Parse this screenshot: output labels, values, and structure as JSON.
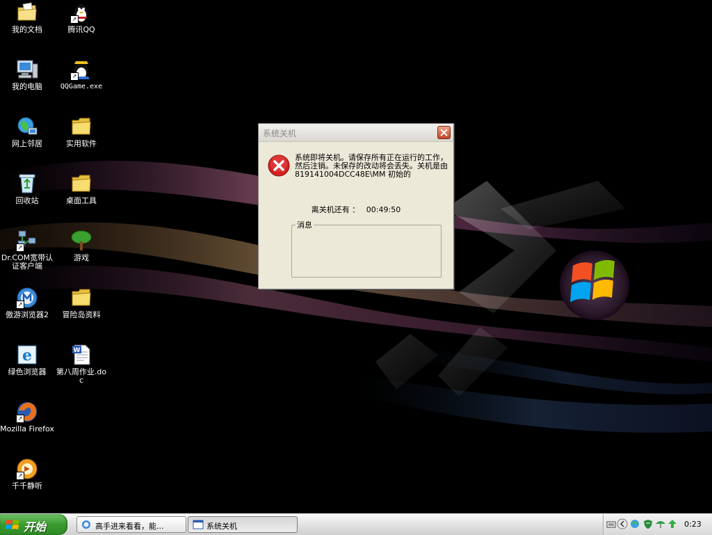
{
  "desktop": {
    "icons_col1": [
      {
        "label": "我的文档"
      },
      {
        "label": "我的电脑"
      },
      {
        "label": "网上邻居"
      },
      {
        "label": "回收站"
      },
      {
        "label": "Dr.COM宽带认证客户端"
      },
      {
        "label": "傲游浏览器2"
      },
      {
        "label": "绿色浏览器"
      },
      {
        "label": "Mozilla Firefox"
      },
      {
        "label": "千千静听"
      }
    ],
    "icons_col2": [
      {
        "label": "腾讯QQ"
      },
      {
        "label": "QQGame.exe"
      },
      {
        "label": "实用软件"
      },
      {
        "label": "桌面工具"
      },
      {
        "label": "游戏"
      },
      {
        "label": "冒险岛资料"
      },
      {
        "label": "第八周作业.doc"
      }
    ]
  },
  "dialog": {
    "title": "系统关机",
    "message": "系统即将关机。请保存所有正在运行的工作，然后注销。未保存的改动将会丢失。关机是由 819141004DCC48E\\MM 初始的",
    "countdown_label": "离关机还有 ：",
    "countdown_value": "00:49:50",
    "group_label": "消息"
  },
  "taskbar": {
    "start_label": "开始",
    "tasks": [
      {
        "label": "高手进来看看，能..."
      },
      {
        "label": "系统关机"
      }
    ],
    "clock": "0:23"
  },
  "colors": {
    "taskbar_start_green": "#3a9a2e",
    "error_red": "#d42020",
    "dialog_bg": "#ece9d8"
  }
}
